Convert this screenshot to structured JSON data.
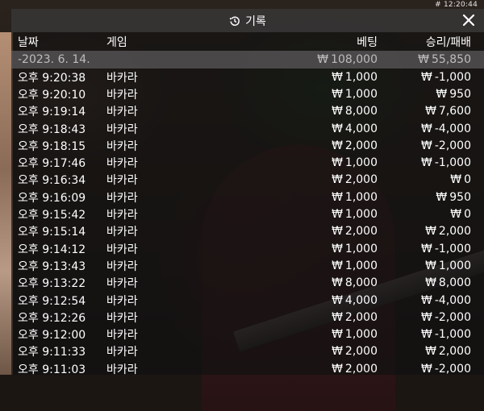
{
  "clock": "# 12:20:44",
  "dialog": {
    "title": "기록",
    "icon": "history-icon",
    "close_icon": "close-icon"
  },
  "columns": {
    "date": "날짜",
    "game": "게임",
    "bet": "베팅",
    "result": "승리/패배"
  },
  "currency": "₩",
  "summary": {
    "date": "-2023. 6. 14.",
    "bet": "108,000",
    "result": "55,850"
  },
  "rows": [
    {
      "time": "오후 9:20:38",
      "game": "바카라",
      "bet": "1,000",
      "result": "-1,000"
    },
    {
      "time": "오후 9:20:10",
      "game": "바카라",
      "bet": "1,000",
      "result": "950"
    },
    {
      "time": "오후 9:19:14",
      "game": "바카라",
      "bet": "8,000",
      "result": "7,600"
    },
    {
      "time": "오후 9:18:43",
      "game": "바카라",
      "bet": "4,000",
      "result": "-4,000"
    },
    {
      "time": "오후 9:18:15",
      "game": "바카라",
      "bet": "2,000",
      "result": "-2,000"
    },
    {
      "time": "오후 9:17:46",
      "game": "바카라",
      "bet": "1,000",
      "result": "-1,000"
    },
    {
      "time": "오후 9:16:34",
      "game": "바카라",
      "bet": "2,000",
      "result": "0"
    },
    {
      "time": "오후 9:16:09",
      "game": "바카라",
      "bet": "1,000",
      "result": "950"
    },
    {
      "time": "오후 9:15:42",
      "game": "바카라",
      "bet": "1,000",
      "result": "0"
    },
    {
      "time": "오후 9:15:14",
      "game": "바카라",
      "bet": "2,000",
      "result": "2,000"
    },
    {
      "time": "오후 9:14:12",
      "game": "바카라",
      "bet": "1,000",
      "result": "-1,000"
    },
    {
      "time": "오후 9:13:43",
      "game": "바카라",
      "bet": "1,000",
      "result": "1,000"
    },
    {
      "time": "오후 9:13:22",
      "game": "바카라",
      "bet": "8,000",
      "result": "8,000"
    },
    {
      "time": "오후 9:12:54",
      "game": "바카라",
      "bet": "4,000",
      "result": "-4,000"
    },
    {
      "time": "오후 9:12:26",
      "game": "바카라",
      "bet": "2,000",
      "result": "-2,000"
    },
    {
      "time": "오후 9:12:00",
      "game": "바카라",
      "bet": "1,000",
      "result": "-1,000"
    },
    {
      "time": "오후 9:11:33",
      "game": "바카라",
      "bet": "2,000",
      "result": "2,000"
    },
    {
      "time": "오후 9:11:03",
      "game": "바카라",
      "bet": "2,000",
      "result": "-2,000"
    }
  ]
}
